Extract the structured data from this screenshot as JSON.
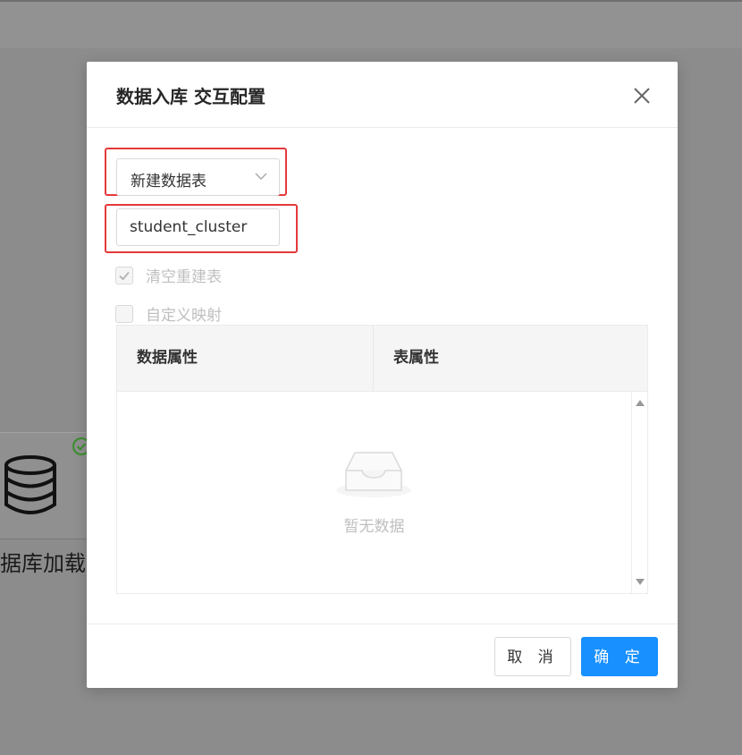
{
  "background": {
    "node_label": "据库加载"
  },
  "modal": {
    "title": "数据入库 交互配置",
    "table_mode_select": {
      "value": "新建数据表"
    },
    "table_name_input": {
      "value": "student_cluster"
    },
    "checkbox_clear_rebuild": {
      "label": "清空重建表",
      "checked": true,
      "disabled": true
    },
    "checkbox_custom_mapping": {
      "label": "自定义映射",
      "checked": false,
      "disabled": true
    },
    "mapping_table": {
      "columns": [
        "数据属性",
        "表属性"
      ],
      "empty_text": "暂无数据"
    },
    "footer": {
      "cancel_label": "取 消",
      "ok_label": "确 定"
    }
  },
  "colors": {
    "primary": "#1890ff",
    "highlight": "#e5393a",
    "success": "#52c41a"
  },
  "icons": [
    "close-icon",
    "chevron-down-icon",
    "check-icon",
    "inbox-icon",
    "database-icon",
    "check-circle-icon",
    "caret-up-icon",
    "caret-down-icon"
  ]
}
